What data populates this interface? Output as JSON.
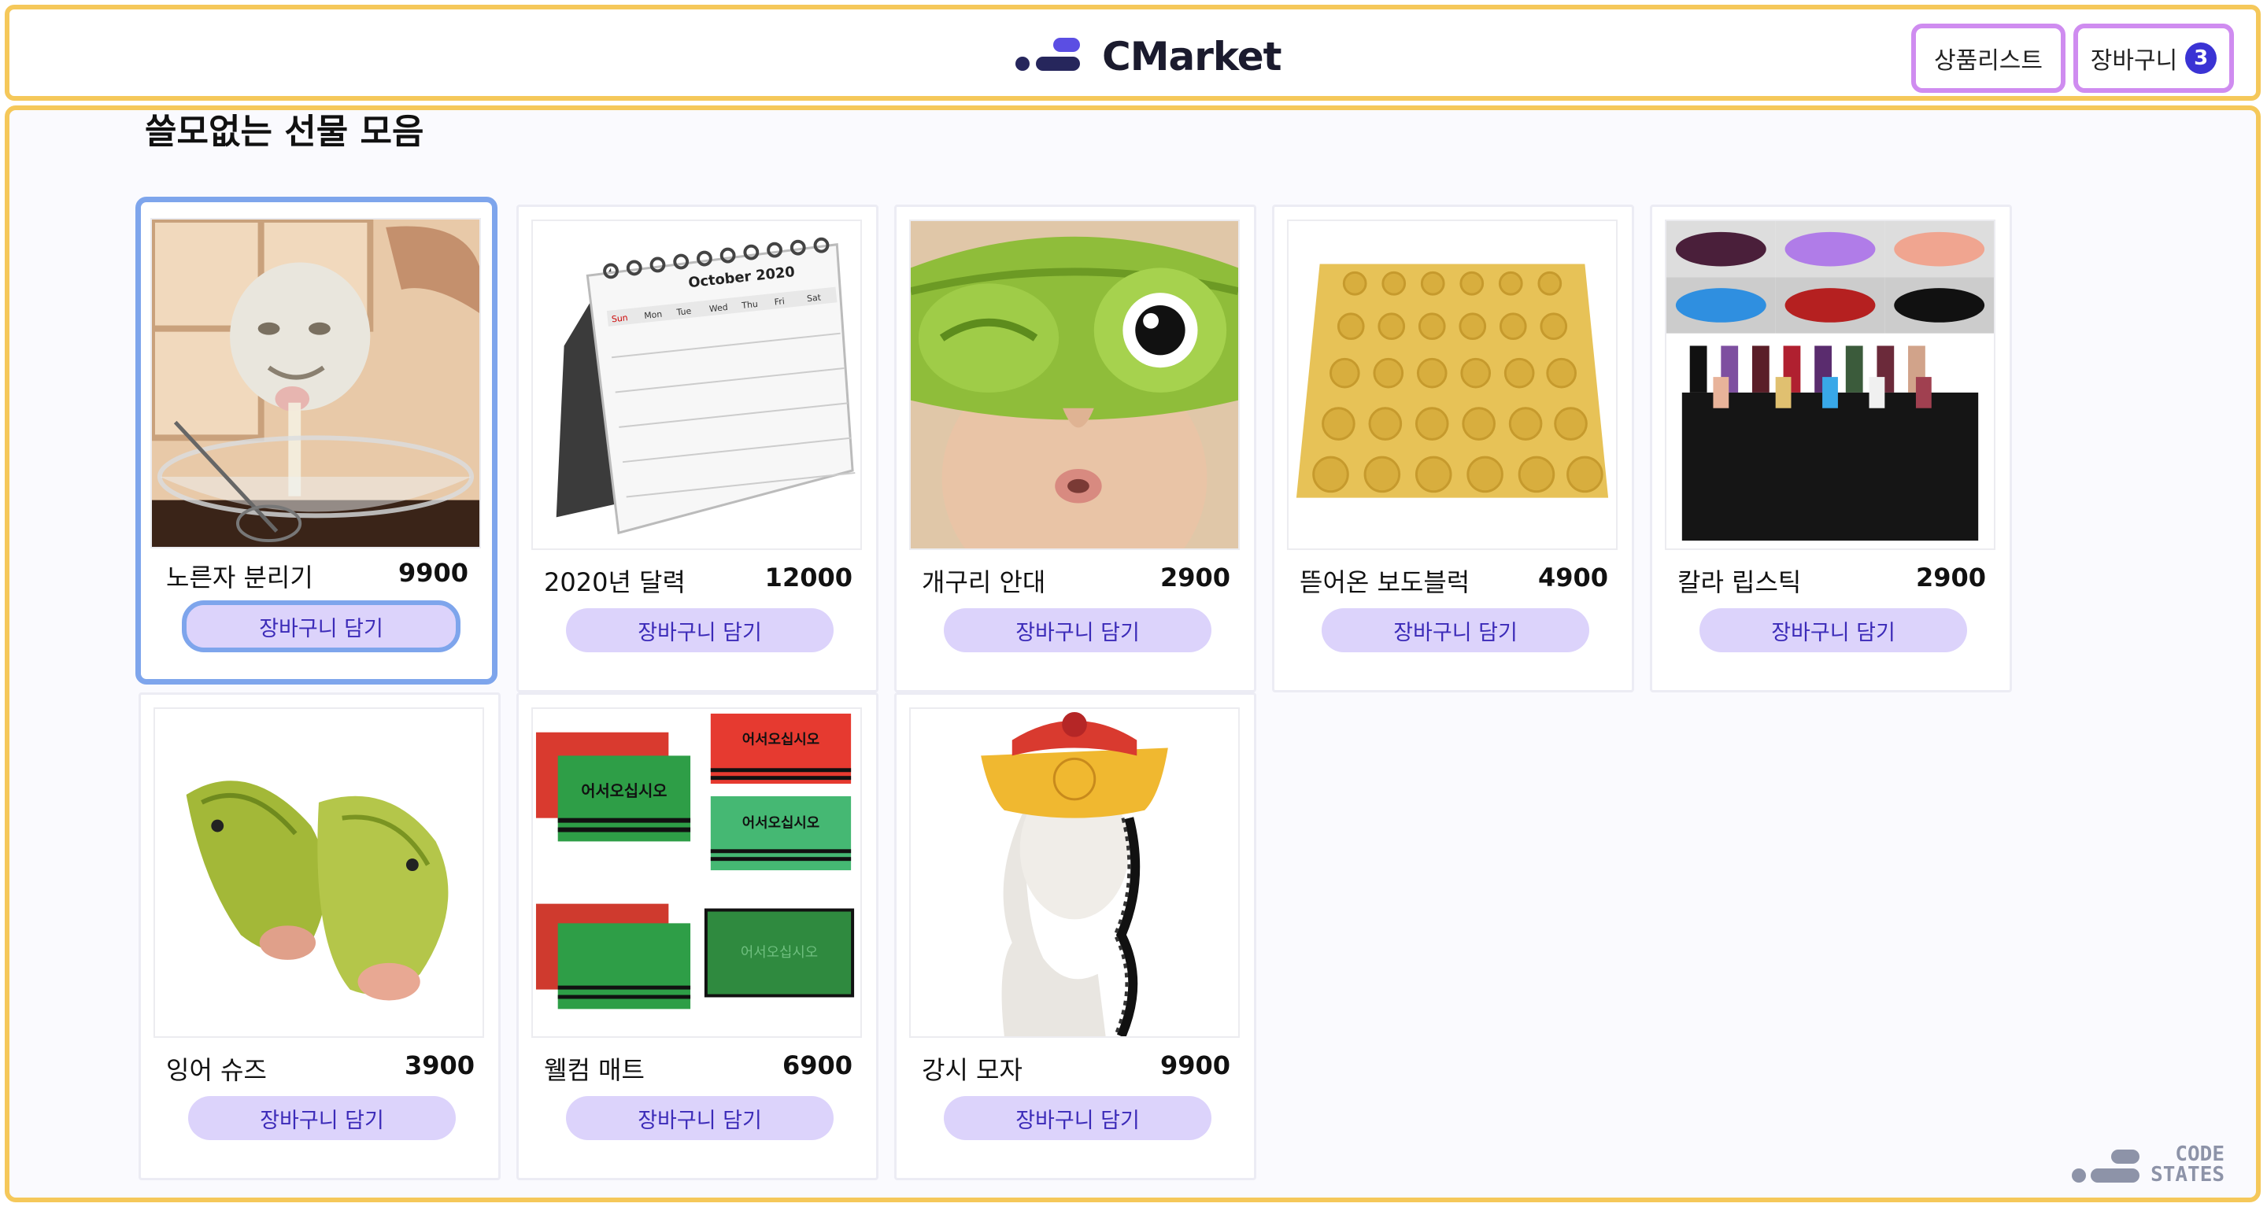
{
  "header": {
    "brand": "CMarket",
    "nav_list_label": "상품리스트",
    "nav_cart_label": "장바구니",
    "cart_count": "3"
  },
  "main": {
    "title": "쓸모없는 선물 모음",
    "add_label": "장바구니 담기",
    "products": [
      {
        "name": "노른자 분리기",
        "price": "9900"
      },
      {
        "name": "2020년 달력",
        "price": "12000"
      },
      {
        "name": "개구리 안대",
        "price": "2900"
      },
      {
        "name": "뜯어온 보도블럭",
        "price": "4900"
      },
      {
        "name": "칼라 립스틱",
        "price": "2900"
      },
      {
        "name": "잉어 슈즈",
        "price": "3900"
      },
      {
        "name": "웰컴 매트",
        "price": "6900"
      },
      {
        "name": "강시 모자",
        "price": "9900"
      }
    ],
    "calendar": {
      "month": "October 2020",
      "days": [
        "Sun",
        "Mon",
        "Tue",
        "Wed",
        "Thu",
        "Fri",
        "Sat"
      ]
    },
    "mat_text": "어서오십시오"
  },
  "footer": {
    "logo_line1": "CODE",
    "logo_line2": "STATES"
  },
  "colors": {
    "frame": "#f5c85a",
    "nav_border": "#cf8cf0",
    "selected_border": "#7ea5ec",
    "button_bg": "#dcd3fb",
    "badge": "#3a33d4"
  }
}
